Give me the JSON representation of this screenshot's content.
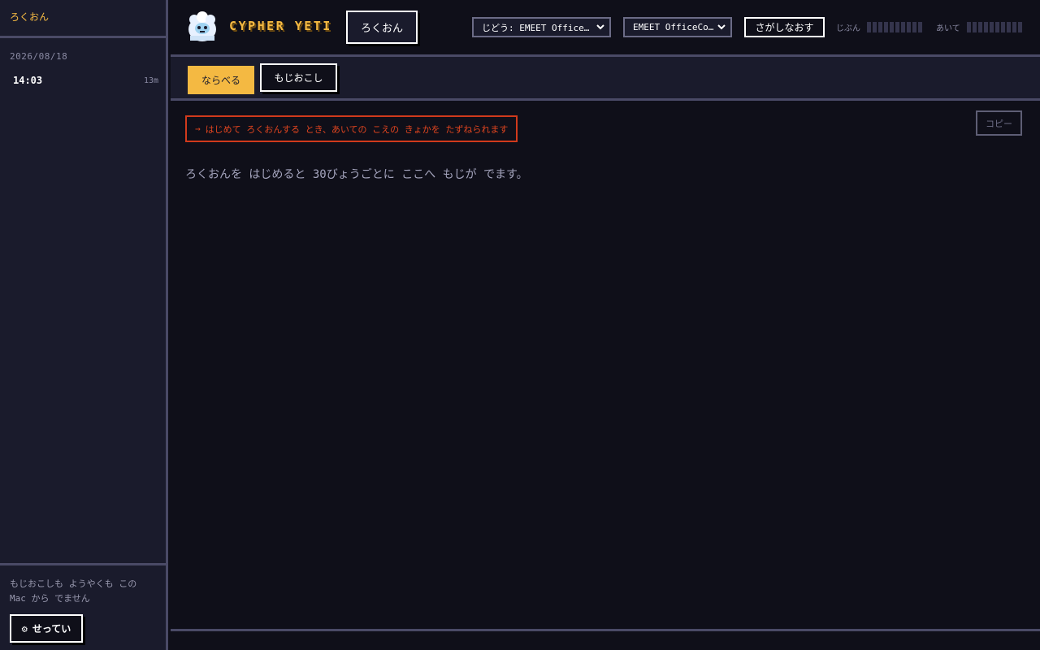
{
  "sidebar": {
    "title": "ろくおん",
    "session_date": "2026/08/18",
    "sessions": [
      {
        "time": "14:03",
        "duration": "13m"
      }
    ],
    "footer_note": "もじおこしも ようやくも この Mac から でません",
    "settings_icon": "⚙",
    "settings_label": "せってい"
  },
  "header": {
    "logo_icon": "yeti-mascot",
    "brand": "CYPHER YETI",
    "record_label": "ろくおん",
    "input_select": "じどう: EMEET Office…",
    "output_select": "EMEET OfficeCo…",
    "retry_label": "さがしなおす",
    "meter_self_label": "じぶん",
    "meter_other_label": "あいて",
    "meter_self_level": 0,
    "meter_other_level": 0
  },
  "tabs": {
    "arrange_label": "ならべる",
    "transcript_label": "もじおこし"
  },
  "main": {
    "notice_arrow": "→",
    "notice_text": "はじめて ろくおんする とき、あいての こえの きょかを たずねられます",
    "copy_label": "コピー",
    "placeholder": "ろくおんを はじめると 30びょうごとに ここへ もじが でます。"
  },
  "colors": {
    "accent": "#f4b942",
    "warning": "#e2451f",
    "background": "#0f0f19",
    "panel": "#1a1b2c",
    "border": "#4a4a66"
  }
}
